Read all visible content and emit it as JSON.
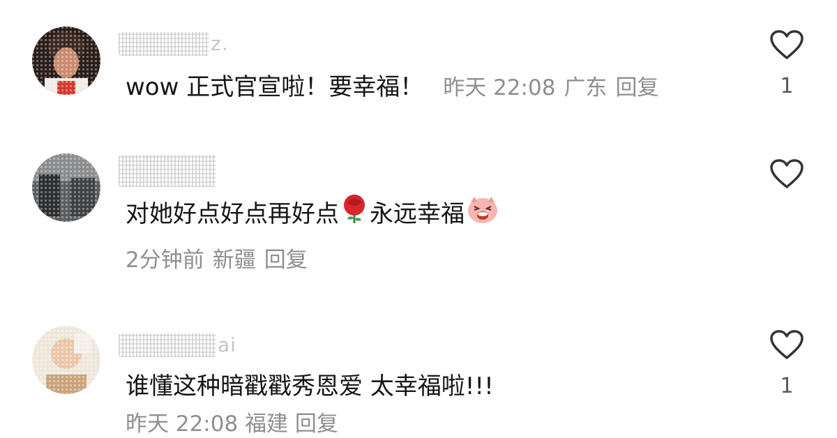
{
  "comments": [
    {
      "username_visible_tail": "z.",
      "text": "wow 正式官宣啦！要幸福！",
      "time": "昨天 22:08",
      "location": "广东",
      "reply": "回复",
      "likes": "1"
    },
    {
      "username_visible_tail": "",
      "text_before_emoji": "对她好点好点再好点",
      "text_after_emoji": "永远幸福",
      "emojis": [
        "rose-emoji",
        "pig-laugh-emoji"
      ],
      "time": "2分钟前",
      "location": "新疆",
      "reply": "回复",
      "likes": ""
    },
    {
      "username_visible_tail": "ai",
      "text": "谁懂这种暗戳戳秀恩爱 太幸福啦!!!",
      "likes": "1",
      "partial_meta": "昨天 22:08 福建 回复"
    }
  ],
  "icons": {
    "like": "heart-outline-icon"
  },
  "colors": {
    "text": "#161616",
    "meta": "#8f8f8f",
    "icon": "#333333"
  }
}
